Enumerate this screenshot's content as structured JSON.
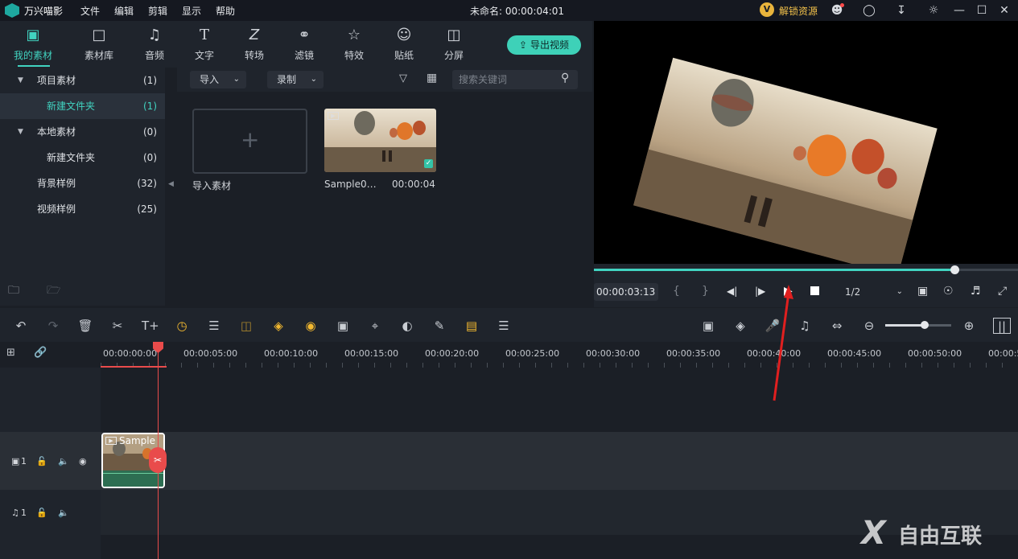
{
  "app": {
    "name": "万兴喵影",
    "project_title": "未命名: 00:00:04:01"
  },
  "menu": [
    "文件",
    "编辑",
    "剪辑",
    "显示",
    "帮助"
  ],
  "unlock_label": "解锁资源",
  "top_tools": [
    {
      "label": "我的素材",
      "icon": "folder-media-icon",
      "active": true
    },
    {
      "label": "素材库",
      "icon": "folder-icon"
    },
    {
      "label": "音频",
      "icon": "music-note-icon"
    },
    {
      "label": "文字",
      "icon": "text-icon"
    },
    {
      "label": "转场",
      "icon": "transition-icon"
    },
    {
      "label": "滤镜",
      "icon": "filter-icon"
    },
    {
      "label": "特效",
      "icon": "effects-icon"
    },
    {
      "label": "贴纸",
      "icon": "sticker-icon"
    },
    {
      "label": "分屏",
      "icon": "split-screen-icon"
    }
  ],
  "export_label": "导出视频",
  "tree": [
    {
      "label": "项目素材",
      "count": "(1)",
      "expanded": true
    },
    {
      "label": "新建文件夹",
      "count": "(1)",
      "selected": true
    },
    {
      "label": "本地素材",
      "count": "(0)",
      "expanded": true
    },
    {
      "label": "新建文件夹",
      "count": "(0)"
    },
    {
      "label": "背景样例",
      "count": "(32)"
    },
    {
      "label": "视频样例",
      "count": "(25)"
    }
  ],
  "library": {
    "import_dropdown": "导入",
    "record_dropdown": "录制",
    "search_placeholder": "搜索关键词",
    "import_tile_label": "导入素材",
    "clip_name": "Sample0…",
    "clip_duration": "00:00:04"
  },
  "player": {
    "timecode": "00:00:03:13",
    "progress": 0.85,
    "quality": "1/2"
  },
  "ruler_labels": [
    "00:00:00:00",
    "00:00:05:00",
    "00:00:10:00",
    "00:00:15:00",
    "00:00:20:00",
    "00:00:25:00",
    "00:00:30:00",
    "00:00:35:00",
    "00:00:40:00",
    "00:00:45:00",
    "00:00:50:00",
    "00:00:5"
  ],
  "tracks": {
    "video_label": "1",
    "audio_label": "1",
    "clip_label": "Sample"
  },
  "zoom_level": 0.6,
  "watermark": "自由互联"
}
